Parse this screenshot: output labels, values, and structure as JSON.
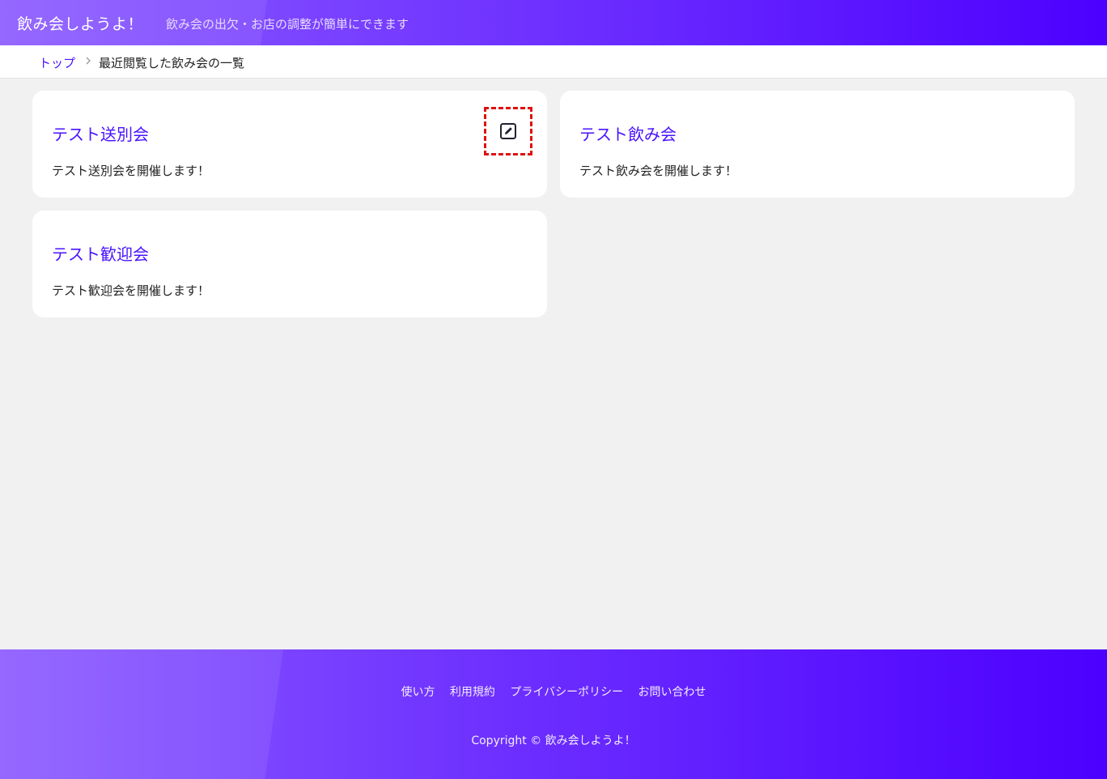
{
  "header": {
    "site_title": "飲み会しようよ！",
    "tagline": "飲み会の出欠・お店の調整が簡単にできます"
  },
  "breadcrumb": {
    "top_label": "トップ",
    "separator_icon": "chevron-right-icon",
    "current_label": "最近閲覧した飲み会の一覧"
  },
  "cards": [
    {
      "title": "テスト送別会",
      "description": "テスト送別会を開催します！",
      "has_edit_icon": true,
      "edit_icon": "edit-square-pencil-icon"
    },
    {
      "title": "テスト飲み会",
      "description": "テスト飲み会を開催します！",
      "has_edit_icon": false
    },
    {
      "title": "テスト歓迎会",
      "description": "テスト歓迎会を開催します！",
      "has_edit_icon": false
    }
  ],
  "footer": {
    "links": [
      "使い方",
      "利用規約",
      "プライバシーポリシー",
      "お問い合わせ"
    ],
    "copyright": "Copyright © 飲み会しようよ！"
  },
  "colors": {
    "accent": "#4a14ff",
    "gradient_start": "#8c5cff",
    "gradient_end": "#4c00ff",
    "highlight_dashed_border": "#e01010",
    "page_background": "#f1f1f1"
  }
}
